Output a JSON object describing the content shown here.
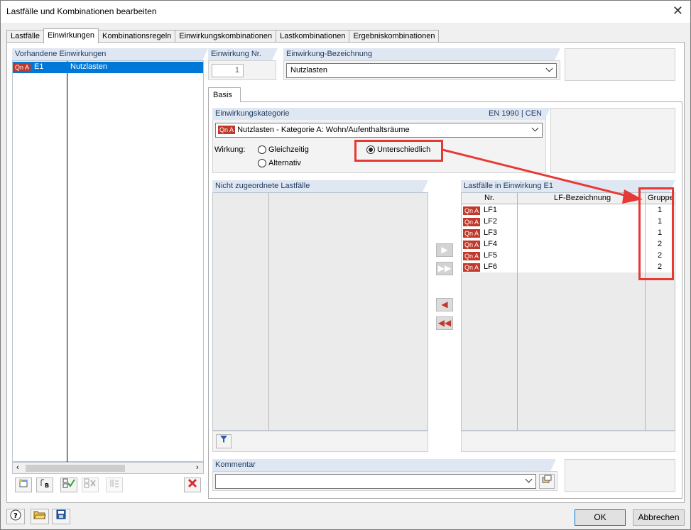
{
  "window": {
    "title": "Lastfälle und Kombinationen bearbeiten",
    "close_glyph": "✕"
  },
  "tabs": [
    {
      "label": "Lastfälle",
      "active": false
    },
    {
      "label": "Einwirkungen",
      "active": true
    },
    {
      "label": "Kombinationsregeln",
      "active": false
    },
    {
      "label": "Einwirkungskombinationen",
      "active": false
    },
    {
      "label": "Lastkombinationen",
      "active": false
    },
    {
      "label": "Ergebniskombinationen",
      "active": false
    }
  ],
  "left_panel": {
    "header": "Vorhandene Einwirkungen",
    "rows": [
      {
        "badge": "Qn A",
        "id": "E1",
        "name": "Nutzlasten",
        "selected": true
      }
    ]
  },
  "einwirkung_nr": {
    "label": "Einwirkung Nr.",
    "value": "1"
  },
  "einwirkung_bez": {
    "label": "Einwirkung-Bezeichnung",
    "value": "Nutzlasten"
  },
  "basis_tab": "Basis",
  "kategorie": {
    "label": "Einwirkungskategorie",
    "norm": "EN 1990 | CEN",
    "badge": "Qn A",
    "value": "Nutzlasten - Kategorie A: Wohn/Aufenthaltsräume"
  },
  "wirkung": {
    "label": "Wirkung:",
    "options": [
      "Gleichzeitig",
      "Alternativ",
      "Unterschiedlich"
    ],
    "selected": "Unterschiedlich"
  },
  "nicht_zugeordnet": {
    "header": "Nicht zugeordnete Lastfälle"
  },
  "lastfaelle": {
    "header": "Lastfälle in Einwirkung E1",
    "columns": [
      "Nr.",
      "LF-Bezeichnung",
      "Gruppe"
    ],
    "rows": [
      {
        "badge": "Qn A",
        "nr": "LF1",
        "bez": "",
        "gruppe": "1"
      },
      {
        "badge": "Qn A",
        "nr": "LF2",
        "bez": "",
        "gruppe": "1"
      },
      {
        "badge": "Qn A",
        "nr": "LF3",
        "bez": "",
        "gruppe": "1"
      },
      {
        "badge": "Qn A",
        "nr": "LF4",
        "bez": "",
        "gruppe": "2"
      },
      {
        "badge": "Qn A",
        "nr": "LF5",
        "bez": "",
        "gruppe": "2"
      },
      {
        "badge": "Qn A",
        "nr": "LF6",
        "bez": "",
        "gruppe": "2"
      }
    ]
  },
  "transfer_buttons": [
    ">",
    ">>",
    "◄",
    "◄◄"
  ],
  "kommentar": {
    "label": "Kommentar",
    "value": ""
  },
  "footer": {
    "ok": "OK",
    "cancel": "Abbrechen"
  },
  "colors": {
    "accent": "#0078d7",
    "badge": "#c0392b",
    "highlight": "#e53935",
    "header": "#dfe7f2"
  }
}
